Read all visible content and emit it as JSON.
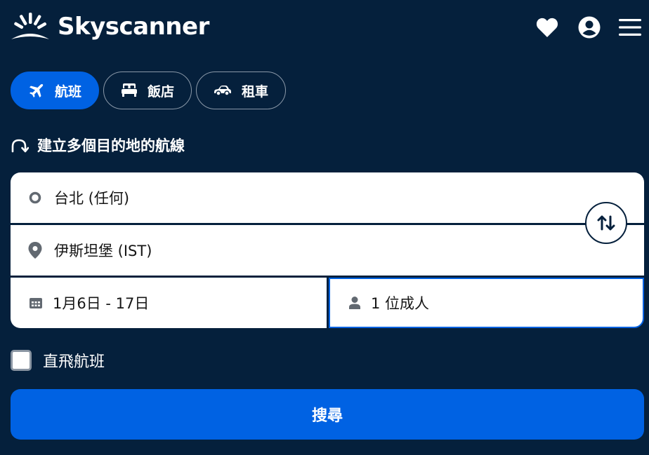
{
  "header": {
    "brand": "Skyscanner",
    "icons": [
      "heart-icon",
      "account-icon",
      "menu-icon"
    ]
  },
  "tabs": [
    {
      "label": "航班",
      "icon": "plane-icon",
      "active": true
    },
    {
      "label": "飯店",
      "icon": "bed-icon",
      "active": false
    },
    {
      "label": "租車",
      "icon": "car-icon",
      "active": false
    }
  ],
  "multicity": {
    "label": "建立多個目的地的航線"
  },
  "form": {
    "origin": "台北 (任何)",
    "destination": "伊斯坦堡 (IST)",
    "dates": "1月6日 - 17日",
    "travellers": "1 位成人"
  },
  "direct": {
    "label": "直飛航班",
    "checked": false
  },
  "search": {
    "label": "搜尋"
  },
  "colors": {
    "background": "#05203c",
    "accent": "#0062e3",
    "field": "#ffffff"
  }
}
